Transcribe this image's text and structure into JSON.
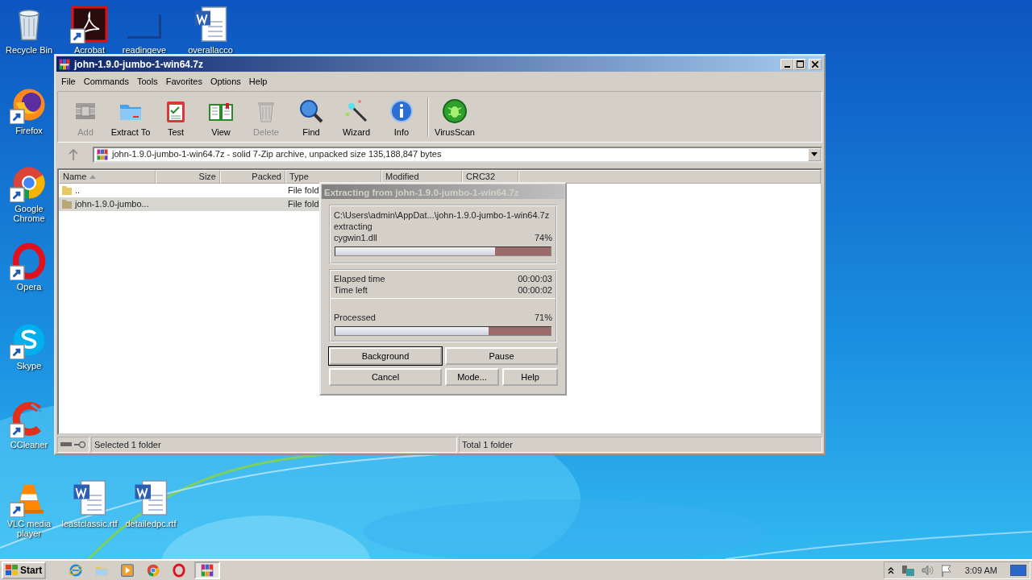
{
  "desktop_icons": [
    {
      "label": "Recycle Bin",
      "kind": "recycle",
      "shortcut": false
    },
    {
      "label": "Acrobat",
      "kind": "acrobat",
      "shortcut": true
    },
    {
      "label": "readingeve",
      "kind": "blank",
      "shortcut": false
    },
    {
      "label": "overallacco",
      "kind": "word",
      "shortcut": false
    },
    {
      "label": "Firefox",
      "kind": "firefox",
      "shortcut": true
    },
    {
      "label": "Google Chrome",
      "kind": "chrome",
      "shortcut": true
    },
    {
      "label": "Opera",
      "kind": "opera",
      "shortcut": true
    },
    {
      "label": "Skype",
      "kind": "skype",
      "shortcut": true
    },
    {
      "label": "CCleaner",
      "kind": "ccleaner",
      "shortcut": true
    },
    {
      "label": "VLC media player",
      "kind": "vlc",
      "shortcut": true
    },
    {
      "label": "leastclassic.rtf",
      "kind": "word",
      "shortcut": false
    },
    {
      "label": "detailedpc.rtf",
      "kind": "word",
      "shortcut": false
    }
  ],
  "window": {
    "title": "john-1.9.0-jumbo-1-win64.7z",
    "menu": [
      "File",
      "Commands",
      "Tools",
      "Favorites",
      "Options",
      "Help"
    ],
    "toolbar": [
      {
        "label": "Add",
        "kind": "add",
        "disabled": true
      },
      {
        "label": "Extract To",
        "kind": "extract",
        "disabled": false
      },
      {
        "label": "Test",
        "kind": "test",
        "disabled": false
      },
      {
        "label": "View",
        "kind": "view",
        "disabled": false
      },
      {
        "label": "Delete",
        "kind": "delete",
        "disabled": true
      },
      {
        "label": "Find",
        "kind": "find",
        "disabled": false
      },
      {
        "label": "Wizard",
        "kind": "wizard",
        "disabled": false
      },
      {
        "label": "Info",
        "kind": "info",
        "disabled": false
      },
      {
        "label": "VirusScan",
        "kind": "virus",
        "disabled": false
      }
    ],
    "address": "john-1.9.0-jumbo-1-win64.7z - solid 7-Zip archive, unpacked size 135,188,847 bytes",
    "columns": [
      "Name",
      "Size",
      "Packed",
      "Type",
      "Modified",
      "CRC32"
    ],
    "rows": [
      {
        "name": "..",
        "type": "File fold",
        "selected": false
      },
      {
        "name": "john-1.9.0-jumbo...",
        "type": "File fold",
        "selected": true
      }
    ],
    "status": {
      "left": "Selected 1 folder",
      "right": "Total 1 folder"
    }
  },
  "dialog": {
    "title": "Extracting from john-1.9.0-jumbo-1-win64.7z",
    "archive_path": "C:\\Users\\admin\\AppDat...\\john-1.9.0-jumbo-1-win64.7z",
    "action": "extracting",
    "file": "cygwin1.dll",
    "file_percent": "74%",
    "file_progress": {
      "level": 0.74
    },
    "times": [
      {
        "label": "Elapsed time",
        "value": "00:00:03"
      },
      {
        "label": "Time left",
        "value": "00:00:02"
      }
    ],
    "processed_label": "Processed",
    "processed_percent": "71%",
    "processed_progress": {
      "level": 0.71
    },
    "buttons": [
      {
        "label": "Background",
        "default": true
      },
      {
        "label": "Pause",
        "default": false
      },
      {
        "label": "Cancel",
        "default": false
      },
      {
        "label": "Mode...",
        "default": false
      },
      {
        "label": "Help",
        "default": false
      }
    ]
  },
  "taskbar": {
    "start": "Start",
    "apps": [
      {
        "kind": "ie",
        "active": false
      },
      {
        "kind": "explorer",
        "active": false
      },
      {
        "kind": "media",
        "active": false
      },
      {
        "kind": "chrome",
        "active": false
      },
      {
        "kind": "opera",
        "active": false
      },
      {
        "kind": "winrar",
        "active": true
      }
    ],
    "clock": "3:09 AM"
  }
}
